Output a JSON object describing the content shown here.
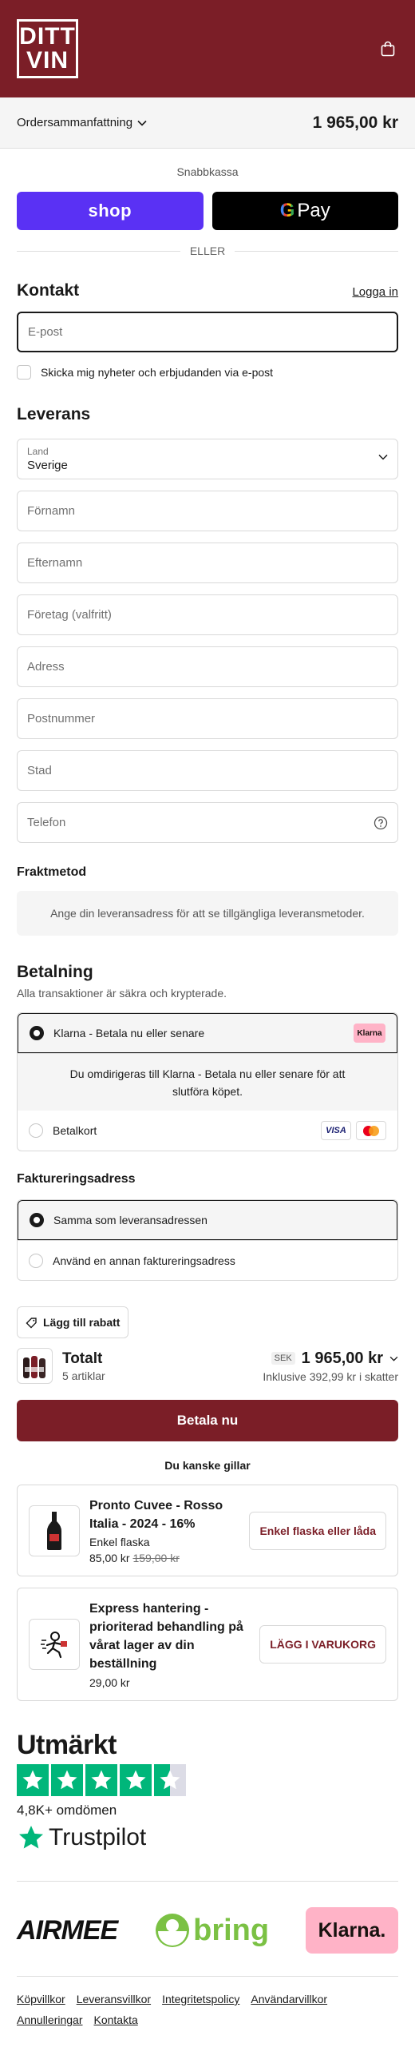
{
  "header": {
    "logo_line1": "DITT",
    "logo_line2": "VIN",
    "cart_icon": "shopping-bag-icon"
  },
  "summary": {
    "label": "Ordersammanfattning",
    "total": "1 965,00 kr"
  },
  "express": {
    "label": "Snabbkassa",
    "shop_label": "shop",
    "gpay_label": "Pay",
    "or_label": "ELLER"
  },
  "contact": {
    "title": "Kontakt",
    "login": "Logga in",
    "email_placeholder": "E-post",
    "newsletter": "Skicka mig nyheter och erbjudanden via e-post"
  },
  "delivery": {
    "title": "Leverans",
    "country_label": "Land",
    "country_value": "Sverige",
    "first_name": "Förnamn",
    "last_name": "Efternamn",
    "company": "Företag (valfritt)",
    "address": "Adress",
    "postal": "Postnummer",
    "city": "Stad",
    "phone": "Telefon"
  },
  "shipping": {
    "title": "Fraktmetod",
    "info": "Ange din leveransadress för att se tillgängliga leveransmetoder."
  },
  "payment": {
    "title": "Betalning",
    "subtitle": "Alla transaktioner är säkra och krypterade.",
    "klarna_label": "Klarna - Betala nu eller senare",
    "klarna_badge": "Klarna",
    "klarna_detail": "Du omdirigeras till Klarna - Betala nu eller senare för att slutföra köpet.",
    "card_label": "Betalkort",
    "visa": "VISA"
  },
  "billing": {
    "title": "Faktureringsadress",
    "same": "Samma som leveransadressen",
    "other": "Använd en annan faktureringsadress"
  },
  "discount": {
    "label": "Lägg till rabatt"
  },
  "total": {
    "title": "Totalt",
    "count": "5 artiklar",
    "currency": "SEK",
    "amount": "1 965,00 kr",
    "tax": "Inklusive 392,99 kr i skatter"
  },
  "pay_button": "Betala nu",
  "upsell": {
    "title": "Du kanske gillar",
    "items": [
      {
        "name": "Pronto Cuvee - Rosso Italia - 2024 - 16%",
        "variant": "Enkel flaska",
        "price": "85,00 kr",
        "compare_price": "159,00 kr",
        "button": "Enkel flaska eller låda"
      },
      {
        "name": "Express hantering - prioriterad behandling på vårat lager av din beställning",
        "price": "29,00 kr",
        "button": "LÄGG I VARUKORG"
      }
    ]
  },
  "trustpilot": {
    "rating_word": "Utmärkt",
    "rating": 4.5,
    "reviews": "4,8K+ omdömen",
    "brand": "Trustpilot"
  },
  "partners": {
    "airmee": "AIRMEE",
    "bring": "bring",
    "klarna": "Klarna."
  },
  "footer": {
    "links": [
      "Köpvillkor",
      "Leveransvillkor",
      "Integritetspolicy",
      "Användarvillkor",
      "Annulleringar",
      "Kontakta"
    ]
  },
  "colors": {
    "brand": "#7b1e27",
    "shop": "#5a31f4",
    "trustpilot": "#00b67a",
    "klarna": "#ffb3c7",
    "bring": "#7bc144"
  }
}
